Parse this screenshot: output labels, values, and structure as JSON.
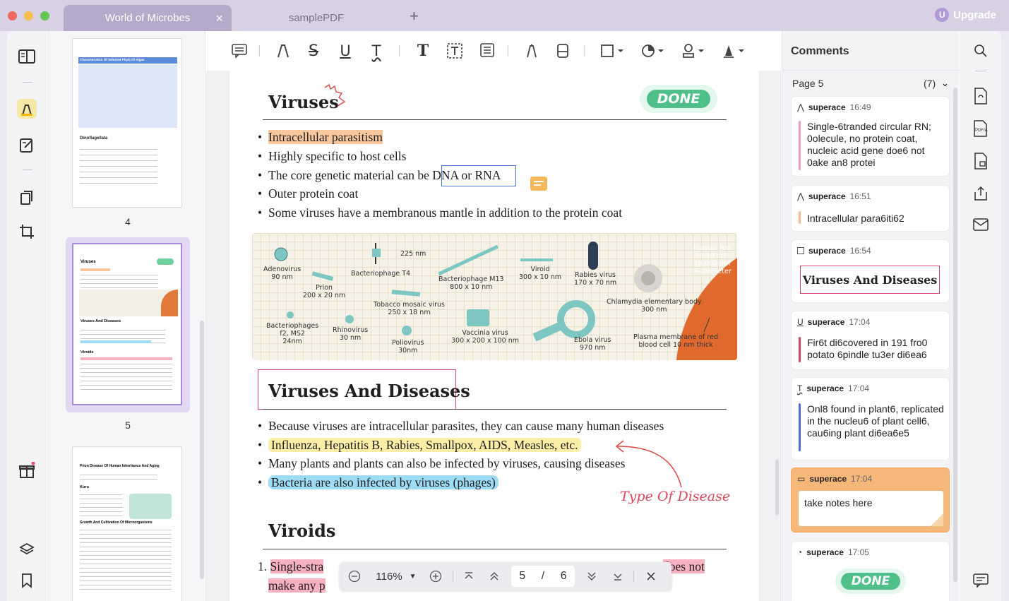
{
  "window": {
    "tabs": [
      {
        "label": "World of Microbes",
        "active": true
      },
      {
        "label": "samplePDF",
        "active": false
      }
    ],
    "new_tab": "+",
    "upgrade_badge": "U",
    "upgrade_label": "Upgrade"
  },
  "thumbnails": {
    "pages": [
      {
        "number": "4"
      },
      {
        "number": "5",
        "selected": true
      },
      {
        "number": ""
      }
    ],
    "thumb4_title": "Characteristics Of Selected Phyla Of Algae",
    "thumb4_section": "Dinoflagellata",
    "thumb5_title": "Viruses",
    "thumb5_section": "Viruses And Diseases",
    "thumb5_section2": "Viroids",
    "thumb6_title": "Prion Disease Of Human Inheritance And Aging",
    "thumb6_section": "Kuru",
    "thumb6_section2": "Growth And Cultivation Of Microorganisms"
  },
  "document": {
    "section1": {
      "title": "Viruses",
      "done_stamp": "DONE",
      "bullets": [
        "Intracellular parasitism",
        "Highly specific to host cells",
        "The core genetic material can be DNA or RNA",
        "Outer protein coat",
        "Some viruses have a membranous mantle in addition to the protein coat"
      ]
    },
    "illustration_labels": {
      "adenovirus": "Adenovirus\n90 nm",
      "bacteriophage_t4": "Bacteriophage T4",
      "size_225": "225 nm",
      "prion": "Prion\n200 x 20 nm",
      "bacteriophage_m13": "Bacteriophage M13\n800 x 10 nm",
      "viroid": "Viroid\n300 x 10 nm",
      "rabies": "Rabies virus\n170 x 70 nm",
      "human_rbc": "Human red\nblood cell\n10,000 nm\nin diameter",
      "tobacco": "Tobacco mosaic virus\n250 x 18 nm",
      "chlamydia": "Chlamydia elementary body\n300 nm",
      "bacteriophages_fx": "Bacteriophages\nf2, MS2\n24nm",
      "rhinovirus": "Rhinovirus\n30 nm",
      "poliovirus": "Poliovirus\n30nm",
      "vaccinia": "Vaccinia virus\n300 x 200 x 100 nm",
      "ebola": "Ebola virus\n970 nm",
      "plasma": "Plasma membrane of red\nblood cell 10 nm thick"
    },
    "section2": {
      "title": "Viruses And Diseases",
      "bullets": [
        "Because viruses are intracellular parasites, they can cause many human diseases",
        "Influenza, Hepatitis B, Rabies, Smallpox, AIDS, Measles, etc.",
        "Many plants and plants can also be infected by viruses, causing diseases",
        "Bacteria are also infected by viruses (phages)"
      ],
      "handwritten_note": "Type Of Disease"
    },
    "section3": {
      "title": "Viroids",
      "item1_number": "1.",
      "item1_start": "Single-stra",
      "item1_end": "does not",
      "item1_line2": "make any p"
    }
  },
  "zoombar": {
    "zoom": "116%",
    "current_page": "5",
    "separator": "/",
    "total_pages": "6"
  },
  "comments_panel": {
    "title": "Comments",
    "page_label": "Page 5",
    "count": "(7)",
    "items": [
      {
        "author": "superace",
        "time": "16:49",
        "text": "Single-6tranded circular RN; 0olecule, no protein coat, nucleic acid gene doe6 not 0ake an8 protei",
        "bar_color": "#f0a0b4"
      },
      {
        "author": "superace",
        "time": "16:51",
        "text": "Intracellular para6iti62",
        "bar_color": "#f8b98a"
      },
      {
        "author": "superace",
        "time": "16:54",
        "text": "Viruses And Diseases",
        "bar_color": "#d9477a"
      },
      {
        "author": "superace",
        "time": "17:04",
        "text": "Fir6t di6covered in 191 fro0 potato 6pindle tu3er di6ea6",
        "bar_color": "#d9475a"
      },
      {
        "author": "superace",
        "time": "17:04",
        "text": "Onl8 found in plant6, replicated in the nucleu6 of plant cell6, cau6ing plant di6ea6e5",
        "bar_color": "#4a6fd9"
      },
      {
        "author": "superace",
        "time": "17:04",
        "text": "take notes here",
        "bar_color": "#f5b77a"
      },
      {
        "author": "superace",
        "time": "17:05",
        "text": "DONE",
        "bar_color": "#5fb88f"
      }
    ]
  }
}
